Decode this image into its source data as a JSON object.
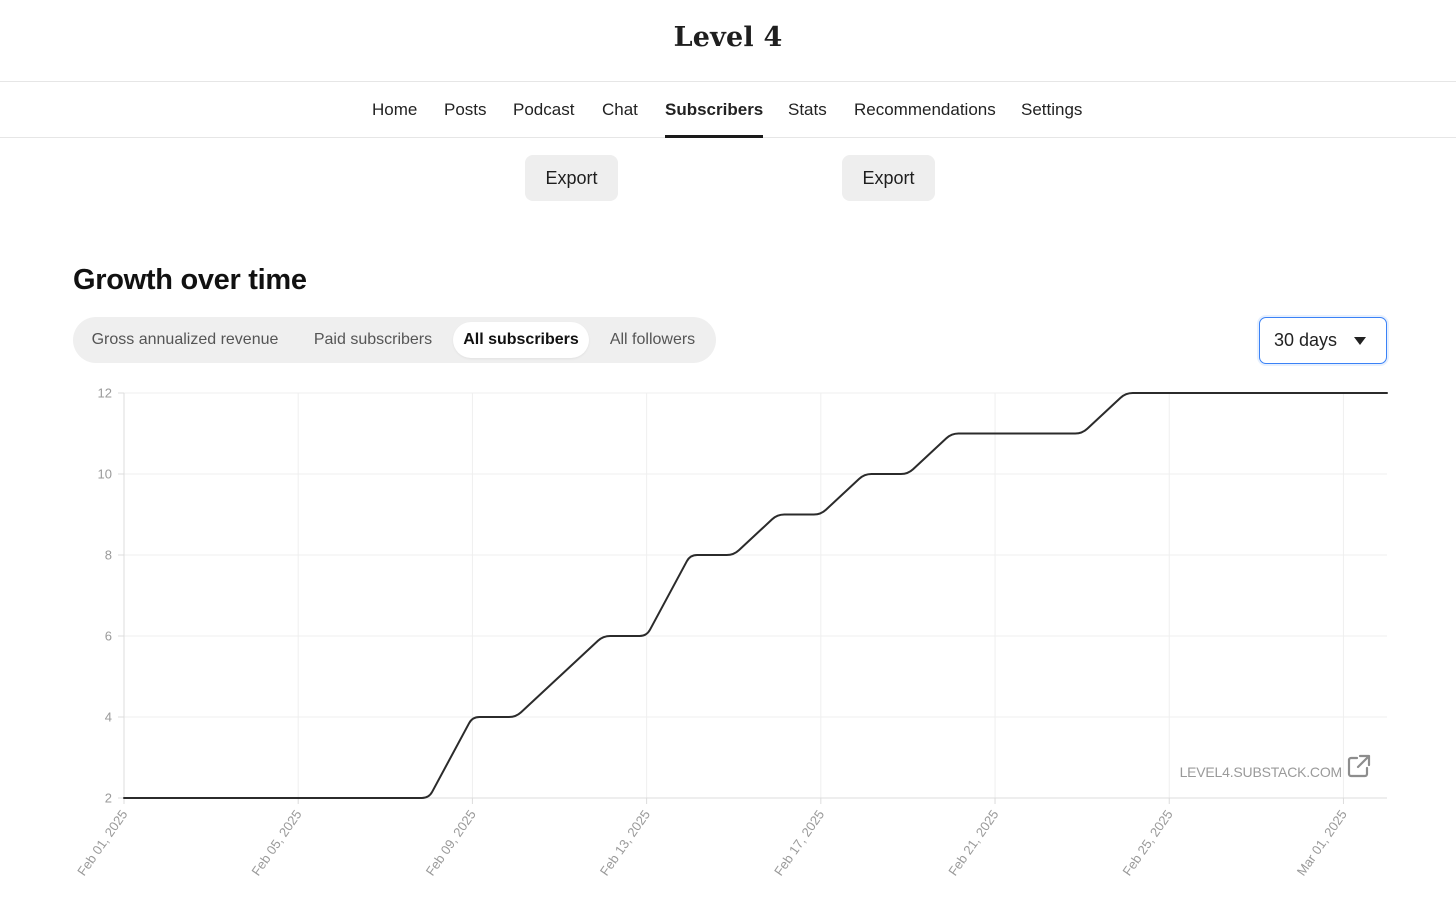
{
  "header": {
    "title": "Level 4"
  },
  "nav": {
    "items": [
      {
        "label": "Home"
      },
      {
        "label": "Posts"
      },
      {
        "label": "Podcast"
      },
      {
        "label": "Chat"
      },
      {
        "label": "Subscribers"
      },
      {
        "label": "Stats"
      },
      {
        "label": "Recommendations"
      },
      {
        "label": "Settings"
      }
    ],
    "active": "Subscribers"
  },
  "actions": {
    "export_label_1": "Export",
    "export_label_2": "Export"
  },
  "growth": {
    "title": "Growth over time",
    "tabs": [
      {
        "label": "Gross annualized revenue"
      },
      {
        "label": "Paid subscribers"
      },
      {
        "label": "All subscribers"
      },
      {
        "label": "All followers"
      }
    ],
    "active_tab": "All subscribers",
    "range": {
      "selected": "30 days",
      "icon": "caret-down-icon"
    },
    "accent_color": "#3b82f6"
  },
  "chart_data": {
    "type": "line",
    "x_type": "date",
    "series": [
      {
        "color": "#2b2b2b",
        "points": [
          [
            "2025-02-01",
            2
          ],
          [
            "2025-02-02",
            2
          ],
          [
            "2025-02-03",
            2
          ],
          [
            "2025-02-04",
            2
          ],
          [
            "2025-02-05",
            2
          ],
          [
            "2025-02-06",
            2
          ],
          [
            "2025-02-07",
            2
          ],
          [
            "2025-02-08",
            2
          ],
          [
            "2025-02-09",
            4
          ],
          [
            "2025-02-10",
            4
          ],
          [
            "2025-02-11",
            5
          ],
          [
            "2025-02-12",
            6
          ],
          [
            "2025-02-13",
            6
          ],
          [
            "2025-02-14",
            8
          ],
          [
            "2025-02-15",
            8
          ],
          [
            "2025-02-16",
            9
          ],
          [
            "2025-02-17",
            9
          ],
          [
            "2025-02-18",
            10
          ],
          [
            "2025-02-19",
            10
          ],
          [
            "2025-02-20",
            11
          ],
          [
            "2025-02-21",
            11
          ],
          [
            "2025-02-22",
            11
          ],
          [
            "2025-02-23",
            11
          ],
          [
            "2025-02-24",
            12
          ],
          [
            "2025-02-25",
            12
          ],
          [
            "2025-02-26",
            12
          ],
          [
            "2025-02-27",
            12
          ],
          [
            "2025-02-28",
            12
          ],
          [
            "2025-03-01",
            12
          ],
          [
            "2025-03-02",
            12
          ]
        ]
      }
    ],
    "y_ticks": [
      2,
      4,
      6,
      8,
      10,
      12
    ],
    "ylim": [
      2,
      12
    ],
    "x_ticks": [
      "Feb 01, 2025",
      "Feb 05, 2025",
      "Feb 09, 2025",
      "Feb 13, 2025",
      "Feb 17, 2025",
      "Feb 21, 2025",
      "Feb 25, 2025",
      "Mar 01, 2025"
    ],
    "x_tick_dates": [
      "2025-02-01",
      "2025-02-05",
      "2025-02-09",
      "2025-02-13",
      "2025-02-17",
      "2025-02-21",
      "2025-02-25",
      "2025-03-01"
    ],
    "xlim": [
      "2025-02-01",
      "2025-03-02"
    ],
    "grid": true,
    "watermark": "LEVEL4.SUBSTACK.COM",
    "watermark_icon": "external-link-icon",
    "gridline_color": "#efefef",
    "axis_color": "#dcdcdc"
  }
}
